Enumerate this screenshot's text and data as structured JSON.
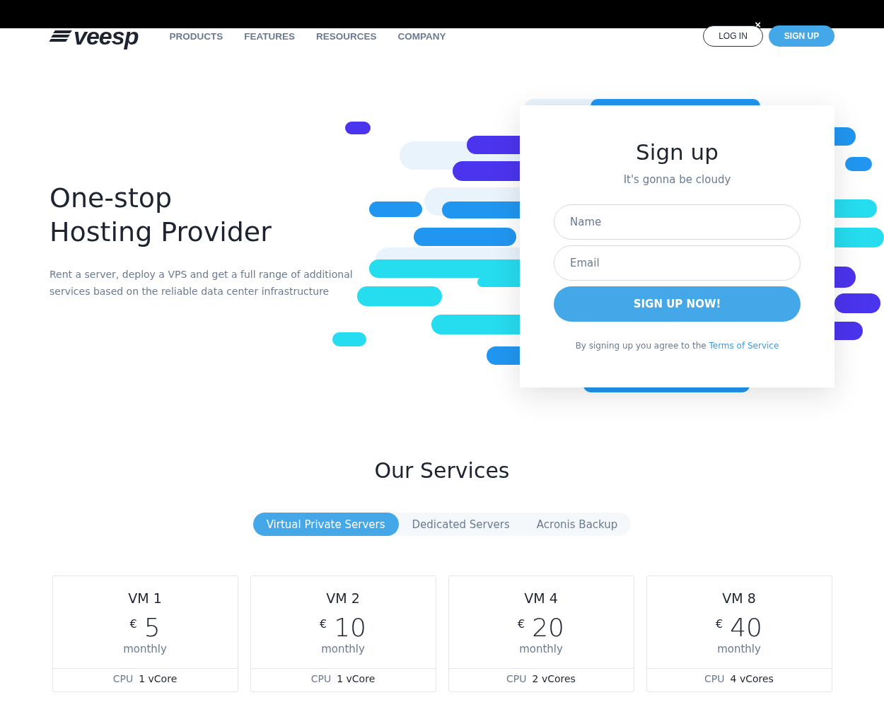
{
  "banner": {
    "close": "×"
  },
  "nav": {
    "logo": "veesp",
    "links": [
      {
        "label": "PRODUCTS"
      },
      {
        "label": "FEATURES"
      },
      {
        "label": "RESOURCES"
      },
      {
        "label": "COMPANY"
      }
    ],
    "login": "LOG IN",
    "signup": "SIGN UP"
  },
  "hero": {
    "title_lines": [
      "One-stop",
      "Hosting Provider"
    ],
    "text": "Rent a server, deploy a VPS and get a full range of additional services based on the reliable data center infrastructure"
  },
  "signup_form": {
    "title": "Sign up",
    "subtitle": "It's gonna be cloudy",
    "fields": [
      {
        "placeholder": "Name"
      },
      {
        "placeholder": "Email"
      }
    ],
    "button": "SIGN UP NOW!",
    "terms_text": "By signing up you agree to the",
    "terms_link": "Terms of Service"
  },
  "services": {
    "title": "Our Services",
    "tabs": [
      {
        "label": "Virtual Private Servers",
        "selected": true
      },
      {
        "label": "Dedicated Servers",
        "selected": false
      },
      {
        "label": "Acronis Backup",
        "selected": false
      }
    ],
    "plans": [
      {
        "name": "VM 1",
        "currency": "€",
        "price": "5",
        "period": "monthly",
        "spec_label": "CPU",
        "spec_value": "1 vCore"
      },
      {
        "name": "VM 2",
        "currency": "€",
        "price": "10",
        "period": "monthly",
        "spec_label": "CPU",
        "spec_value": "1 vCore"
      },
      {
        "name": "VM 4",
        "currency": "€",
        "price": "20",
        "period": "monthly",
        "spec_label": "CPU",
        "spec_value": "2 vCores"
      },
      {
        "name": "VM 8",
        "currency": "€",
        "price": "40",
        "period": "monthly",
        "spec_label": "CPU",
        "spec_value": "4 vCores"
      }
    ]
  }
}
